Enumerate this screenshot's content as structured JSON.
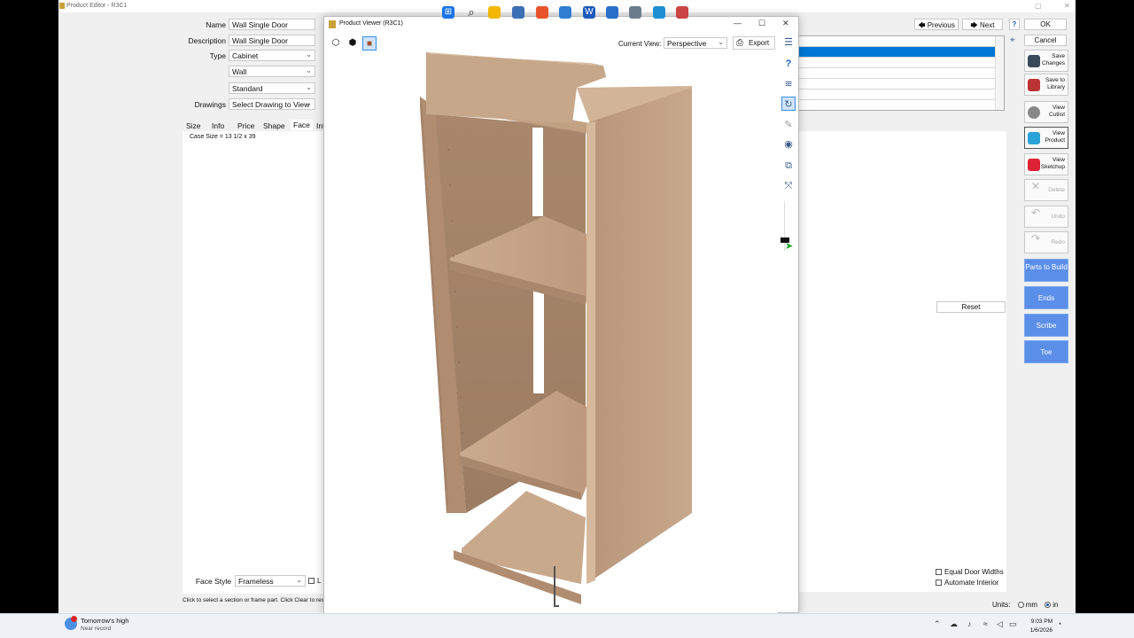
{
  "editor": {
    "title": "Product Editor - R3C1",
    "form": {
      "name_label": "Name",
      "name_value": "Wall Single Door",
      "desc_label": "Description",
      "desc_value": "Wall Single Door",
      "type_label": "Type",
      "type_value": "Cabinet",
      "subtype_value": "Wall",
      "style_value": "Standard",
      "drawings_label": "Drawings",
      "drawings_value": "Select Drawing to View"
    },
    "tabs": [
      "Size",
      "Info",
      "Price",
      "Shape",
      "Face",
      "Int"
    ],
    "case_size": "Case Size = 13 1/2 x 39",
    "face_style_label": "Face Style",
    "face_style_value": "Frameless",
    "face_style_check": "L",
    "status_text": "Click to select a section or frame part. Click Clear to rese",
    "nav": {
      "previous": "Previous",
      "next": "Next",
      "help": "?"
    },
    "ok": "OK",
    "cancel": "Cancel",
    "side_buttons": [
      {
        "label1": "Save",
        "label2": "Changes",
        "icon": "floppy-icon",
        "color": "#3a4a5a"
      },
      {
        "label1": "Save to",
        "label2": "Library",
        "icon": "books-icon",
        "color": "#b33"
      },
      {
        "label1": "View",
        "label2": "Cutlist",
        "icon": "saw-blade-icon",
        "color": "#888"
      },
      {
        "label1": "View",
        "label2": "Product",
        "icon": "product-3d-icon",
        "color": "#2aa3d8"
      },
      {
        "label1": "View",
        "label2": "Sketchup",
        "icon": "sketchup-icon",
        "color": "#d23"
      },
      {
        "label1": "",
        "label2": "Delete",
        "icon": "delete-x-icon",
        "color": "#bbb"
      },
      {
        "label1": "",
        "label2": "Undo",
        "icon": "undo-icon",
        "color": "#bbb"
      },
      {
        "label1": "",
        "label2": "Redo",
        "icon": "redo-icon",
        "color": "#bbb"
      }
    ],
    "blue_buttons": [
      "Parts to Build",
      "Ends",
      "Scribe",
      "Toe"
    ],
    "reset": "Reset",
    "equal_door_widths": "Equal Door Widths",
    "automate_interior": "Automate Interior",
    "units_label": "Units:",
    "unit_mm": "mm",
    "unit_in": "in",
    "unit_selected": "in"
  },
  "viewer": {
    "title": "Product Viewer (R3C1)",
    "current_view_label": "Current View:",
    "current_view_value": "Perspective",
    "export_label": "Export",
    "tool_icons": [
      "wireframe-cube-icon",
      "outline-cube-icon",
      "solid-cube-icon"
    ],
    "side_icons": [
      "settings-icon",
      "help-icon",
      "layers-icon",
      "rotate-icon",
      "pen-icon",
      "eye-icon",
      "camera-icon",
      "fit-view-icon"
    ]
  },
  "taskbar": {
    "weather_title": "Tomorrow's high",
    "weather_sub": "Near record",
    "time": "9:03 PM",
    "date": "1/6/2026"
  },
  "colors": {
    "accent_blue": "#0078d7",
    "button_blue": "#5b8ee8",
    "wood": "#c2a183"
  }
}
